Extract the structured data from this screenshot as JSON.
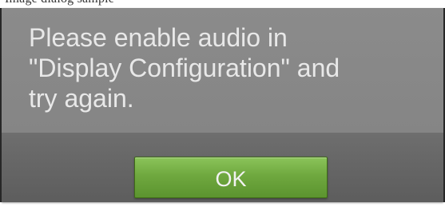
{
  "top_strip": {
    "text": "Image dialog sample"
  },
  "dialog": {
    "message": "Please enable audio in\n\"Display Configuration\" and\ntry again.",
    "ok_label": "OK"
  },
  "colors": {
    "dialog_bg": "#858585",
    "footer_bg": "#626262",
    "button_green": "#6fa83f",
    "text_light": "#e8e8e8"
  }
}
